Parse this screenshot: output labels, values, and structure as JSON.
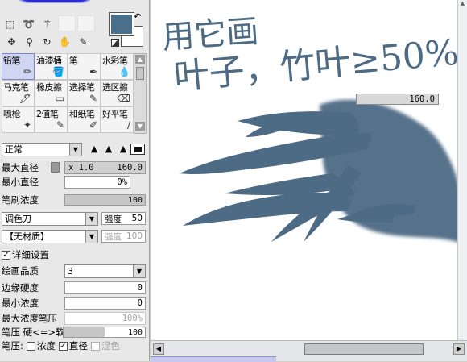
{
  "colors": {
    "foreground": "#4a6f8a",
    "background": "#ffffff",
    "stroke": "#4d6b84"
  },
  "tools": {
    "icons": [
      "move-icon",
      "zoom-icon",
      "rotate-icon",
      "hand-icon",
      "eyedropper-icon",
      "marquee-icon",
      "lasso-icon",
      "magic-wand-icon"
    ]
  },
  "brushes": [
    {
      "label": "铅笔",
      "icon": "pencil-icon",
      "selected": true
    },
    {
      "label": "油漆桶",
      "icon": "bucket-icon",
      "selected": false
    },
    {
      "label": "笔",
      "icon": "pen-icon",
      "selected": false
    },
    {
      "label": "水彩笔",
      "icon": "watercolor-icon",
      "selected": false
    },
    {
      "label": "马克笔",
      "icon": "marker-icon",
      "selected": false
    },
    {
      "label": "橡皮擦",
      "icon": "eraser-icon",
      "selected": false
    },
    {
      "label": "选择笔",
      "icon": "select-pen-icon",
      "selected": false
    },
    {
      "label": "选区擦",
      "icon": "select-eraser-icon",
      "selected": false
    },
    {
      "label": "喷枪",
      "icon": "airbrush-icon",
      "selected": false
    },
    {
      "label": "2值笔",
      "icon": "binary-pen-icon",
      "selected": false
    },
    {
      "label": "和纸笔",
      "icon": "washi-pen-icon",
      "selected": false
    },
    {
      "label": "好平笔",
      "icon": "flat-brush-icon",
      "selected": false
    }
  ],
  "settings": {
    "mode": "正常",
    "max_size_label": "最大直径",
    "max_size_multiplier": "x 1.0",
    "max_size_value": "160.0",
    "min_size_label": "最小直径",
    "min_size_value": "0%",
    "density_label": "笔刷浓度",
    "density_value": "100",
    "density_level": 1.0,
    "blend_select": "调色刀",
    "strength_label": "强度",
    "strength_value": "50",
    "texture_select": "【无材质】",
    "texture_strength_label": "强度",
    "texture_strength_value": "100",
    "detail_label": "详细设置",
    "detail_checked": true,
    "quality_label": "绘画品质",
    "quality_value": "3",
    "edge_hardness_label": "边缘硬度",
    "edge_hardness_value": "0",
    "min_density_label": "最小浓度",
    "min_density_value": "0",
    "max_pressure_label": "最大浓度笔压",
    "max_pressure_value": "100%",
    "pressure_label": "笔压 硬<=>软",
    "pressure_value": "100",
    "pressure_level": 1.0,
    "pressure_opts_label": "笔压:",
    "opt_density": "浓度",
    "opt_density_checked": false,
    "opt_size": "直径",
    "opt_size_checked": true,
    "opt_blend": "混色",
    "opt_blend_checked": false
  },
  "canvas": {
    "size_popup": "160.0",
    "note_line1": "用它画",
    "note_line2": "叶子，竹叶≥50%"
  }
}
